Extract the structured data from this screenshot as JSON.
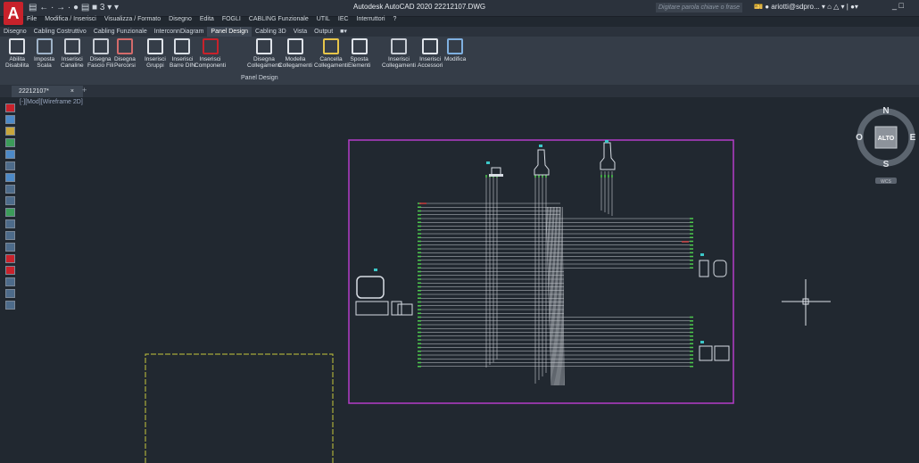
{
  "app": {
    "logo": "A",
    "title": "Autodesk AutoCAD 2020   22212107.DWG",
    "search_placeholder": "Digitare parola chiave o frase",
    "user": "ariotti@sdpro...",
    "quick_access": "▤ ← · → · ● ▤ ■ 3      ▾ ▾"
  },
  "menu": [
    "File",
    "Modifica / Inserisci",
    "Visualizza / Formato",
    "Disegno",
    "Edita",
    "FOGLI",
    "CABLING Funzionale",
    "UTIL",
    "IEC",
    "Interruttori",
    "?"
  ],
  "ribbon_tabs": [
    {
      "label": "Disegno",
      "active": false
    },
    {
      "label": "Cabling Costruttivo",
      "active": false
    },
    {
      "label": "Cabling Funzionale",
      "active": false
    },
    {
      "label": "InterconnDiagram",
      "active": false
    },
    {
      "label": "Panel Design",
      "active": true
    },
    {
      "label": "Cabling 3D",
      "active": false
    },
    {
      "label": "Vista",
      "active": false
    },
    {
      "label": "Output",
      "active": false
    },
    {
      "label": "■▾",
      "active": false
    }
  ],
  "ribbon_buttons": [
    {
      "line1": "Abilita",
      "line2": "Disabilita",
      "icon": "enable-icon"
    },
    {
      "line1": "Imposta",
      "line2": "Scala",
      "icon": "scale-icon"
    },
    {
      "line1": "Inserisci",
      "line2": "Canaline",
      "icon": "duct-icon"
    },
    {
      "line1": "Disegna",
      "line2": "Fascio Fili",
      "icon": "wire-bundle-icon"
    },
    {
      "line1": "Disegna",
      "line2": "Percorsi",
      "icon": "path-icon"
    },
    {
      "line1": "Inserisci",
      "line2": "Gruppi",
      "icon": "group-icon"
    },
    {
      "line1": "Inserisci",
      "line2": "Barre DIN",
      "icon": "din-rail-icon"
    },
    {
      "line1": "Inserisci",
      "line2": "Componenti",
      "icon": "component-icon"
    },
    {
      "line1": "Disegna",
      "line2": "Collegamenti",
      "icon": "draw-link-icon"
    },
    {
      "line1": "Modella",
      "line2": "Collegamenti",
      "icon": "model-link-icon"
    },
    {
      "line1": "Cancella",
      "line2": "Collegamenti",
      "icon": "erase-link-icon"
    },
    {
      "line1": "Sposta",
      "line2": "Elementi",
      "icon": "move-icon"
    },
    {
      "line1": "Inserisci",
      "line2": "Collegamenti",
      "icon": "insert-link-icon"
    },
    {
      "line1": "Inserisci",
      "line2": "Accessori",
      "icon": "accessory-icon"
    },
    {
      "line1": "Modifica",
      "line2": "",
      "icon": "modify-icon"
    }
  ],
  "ribbon_panel_name": "Panel Design",
  "document_tab": "22212107*",
  "document_tab_close": "×",
  "document_tab_add": "+",
  "viewport_label": "[-][Mod][Wireframe 2D]",
  "viewcube": {
    "north": "N",
    "south": "S",
    "east": "E",
    "west": "O",
    "face": "ALTO",
    "wcs": "WCS"
  },
  "colors": {
    "background": "#212830",
    "frame": "#b43cc8",
    "wires": "#c8ccd2",
    "ends": "#4ec84e",
    "sheet": "#c8c83c",
    "accent": "#c8222b"
  }
}
